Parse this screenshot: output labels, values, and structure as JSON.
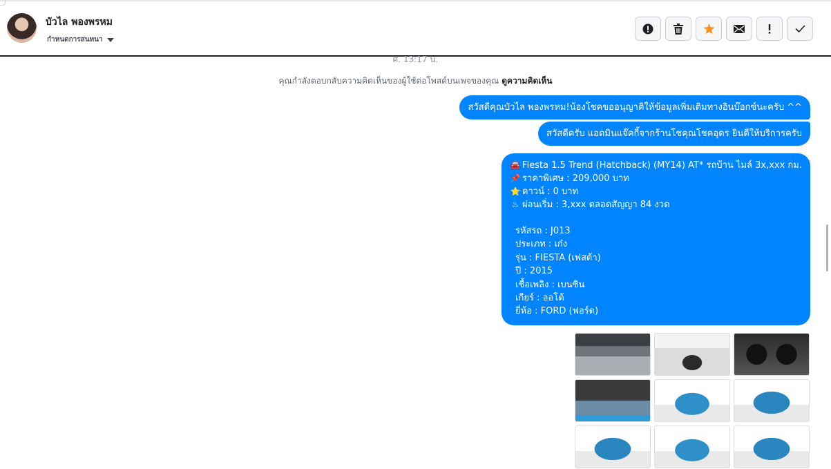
{
  "header": {
    "contact_name": "บัวไล พองพรหม",
    "assign_label": "กำหนดการสนทนา"
  },
  "actions": [
    {
      "name": "spam-alert-icon"
    },
    {
      "name": "trash-icon"
    },
    {
      "name": "star-icon",
      "color": "#f7931e"
    },
    {
      "name": "envelope-icon"
    },
    {
      "name": "exclamation-icon"
    },
    {
      "name": "checkmark-icon"
    }
  ],
  "conversation": {
    "timestamp": "ศ. 13:17 น.",
    "notice_text": "คุณกำลังตอบกลับความคิดเห็นของผู้ใช้ต่อโพสต์บนเพจของคุณ",
    "notice_link": "ดูความคิดเห็น",
    "messages": [
      "สวัสดีคุณบัวไล พองพรหม!น้องโชคขออนุญาติให้ข้อมูลเพิ่มเติมทางอินบ๊อกซ์นะครับ ^^",
      "สวัสดีครับ แอดมินแจ๊คกี้จากร้านโชคุณโชคอุดร ยินดีให้บริการครับ"
    ],
    "listing": {
      "title": "Fiesta 1.5 Trend (Hatchback) (MY14) AT* รถบ้าน ไมล์ 3x,xxx กม.",
      "price": "ราคาพิเศษ : 209,000 บาท",
      "down": "ดาวน์ : 0 บาท",
      "installment": "ผ่อนเริ่ม : 3,xxx ตลอดสัญญา 84 งวด",
      "specs": [
        "รหัสรถ : J013",
        "ประเภท : เก๋ง",
        "รุ่น : FIESTA (เฟสต้า)",
        "ปี : 2015",
        "เชื้อเพลิง : เบนซิน",
        "เกียร์ : ออโต้",
        "ยี่ห้อ : FORD (ฟอร์ด)"
      ]
    },
    "bubble_color": "#0084ff"
  }
}
